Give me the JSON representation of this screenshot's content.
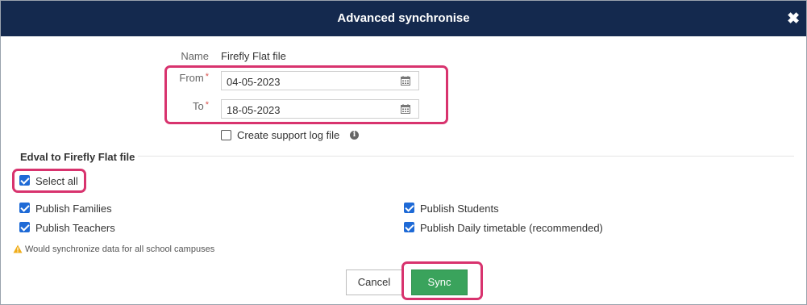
{
  "dialog": {
    "title": "Advanced synchronise",
    "close_icon": "close-icon"
  },
  "form": {
    "name_label": "Name",
    "name_value": "Firefly Flat file",
    "from_label": "From",
    "from_value": "04-05-2023",
    "to_label": "To",
    "to_value": "18-05-2023",
    "required_marker": "*",
    "support_log_label": "Create support log file",
    "support_log_checked": false
  },
  "section": {
    "title": "Edval to Firefly Flat file",
    "select_all_label": "Select all",
    "options": [
      {
        "label": "Publish Families",
        "checked": true
      },
      {
        "label": "Publish Students",
        "checked": true
      },
      {
        "label": "Publish Teachers",
        "checked": true
      },
      {
        "label": "Publish Daily timetable (recommended)",
        "checked": true
      }
    ]
  },
  "note": "Would synchronize data for all school campuses",
  "buttons": {
    "cancel_label": "Cancel",
    "sync_label": "Sync"
  },
  "colors": {
    "titlebar": "#14294e",
    "highlight": "#d8336e",
    "sync": "#3aa35c",
    "checkbox": "#1e6ad6"
  }
}
